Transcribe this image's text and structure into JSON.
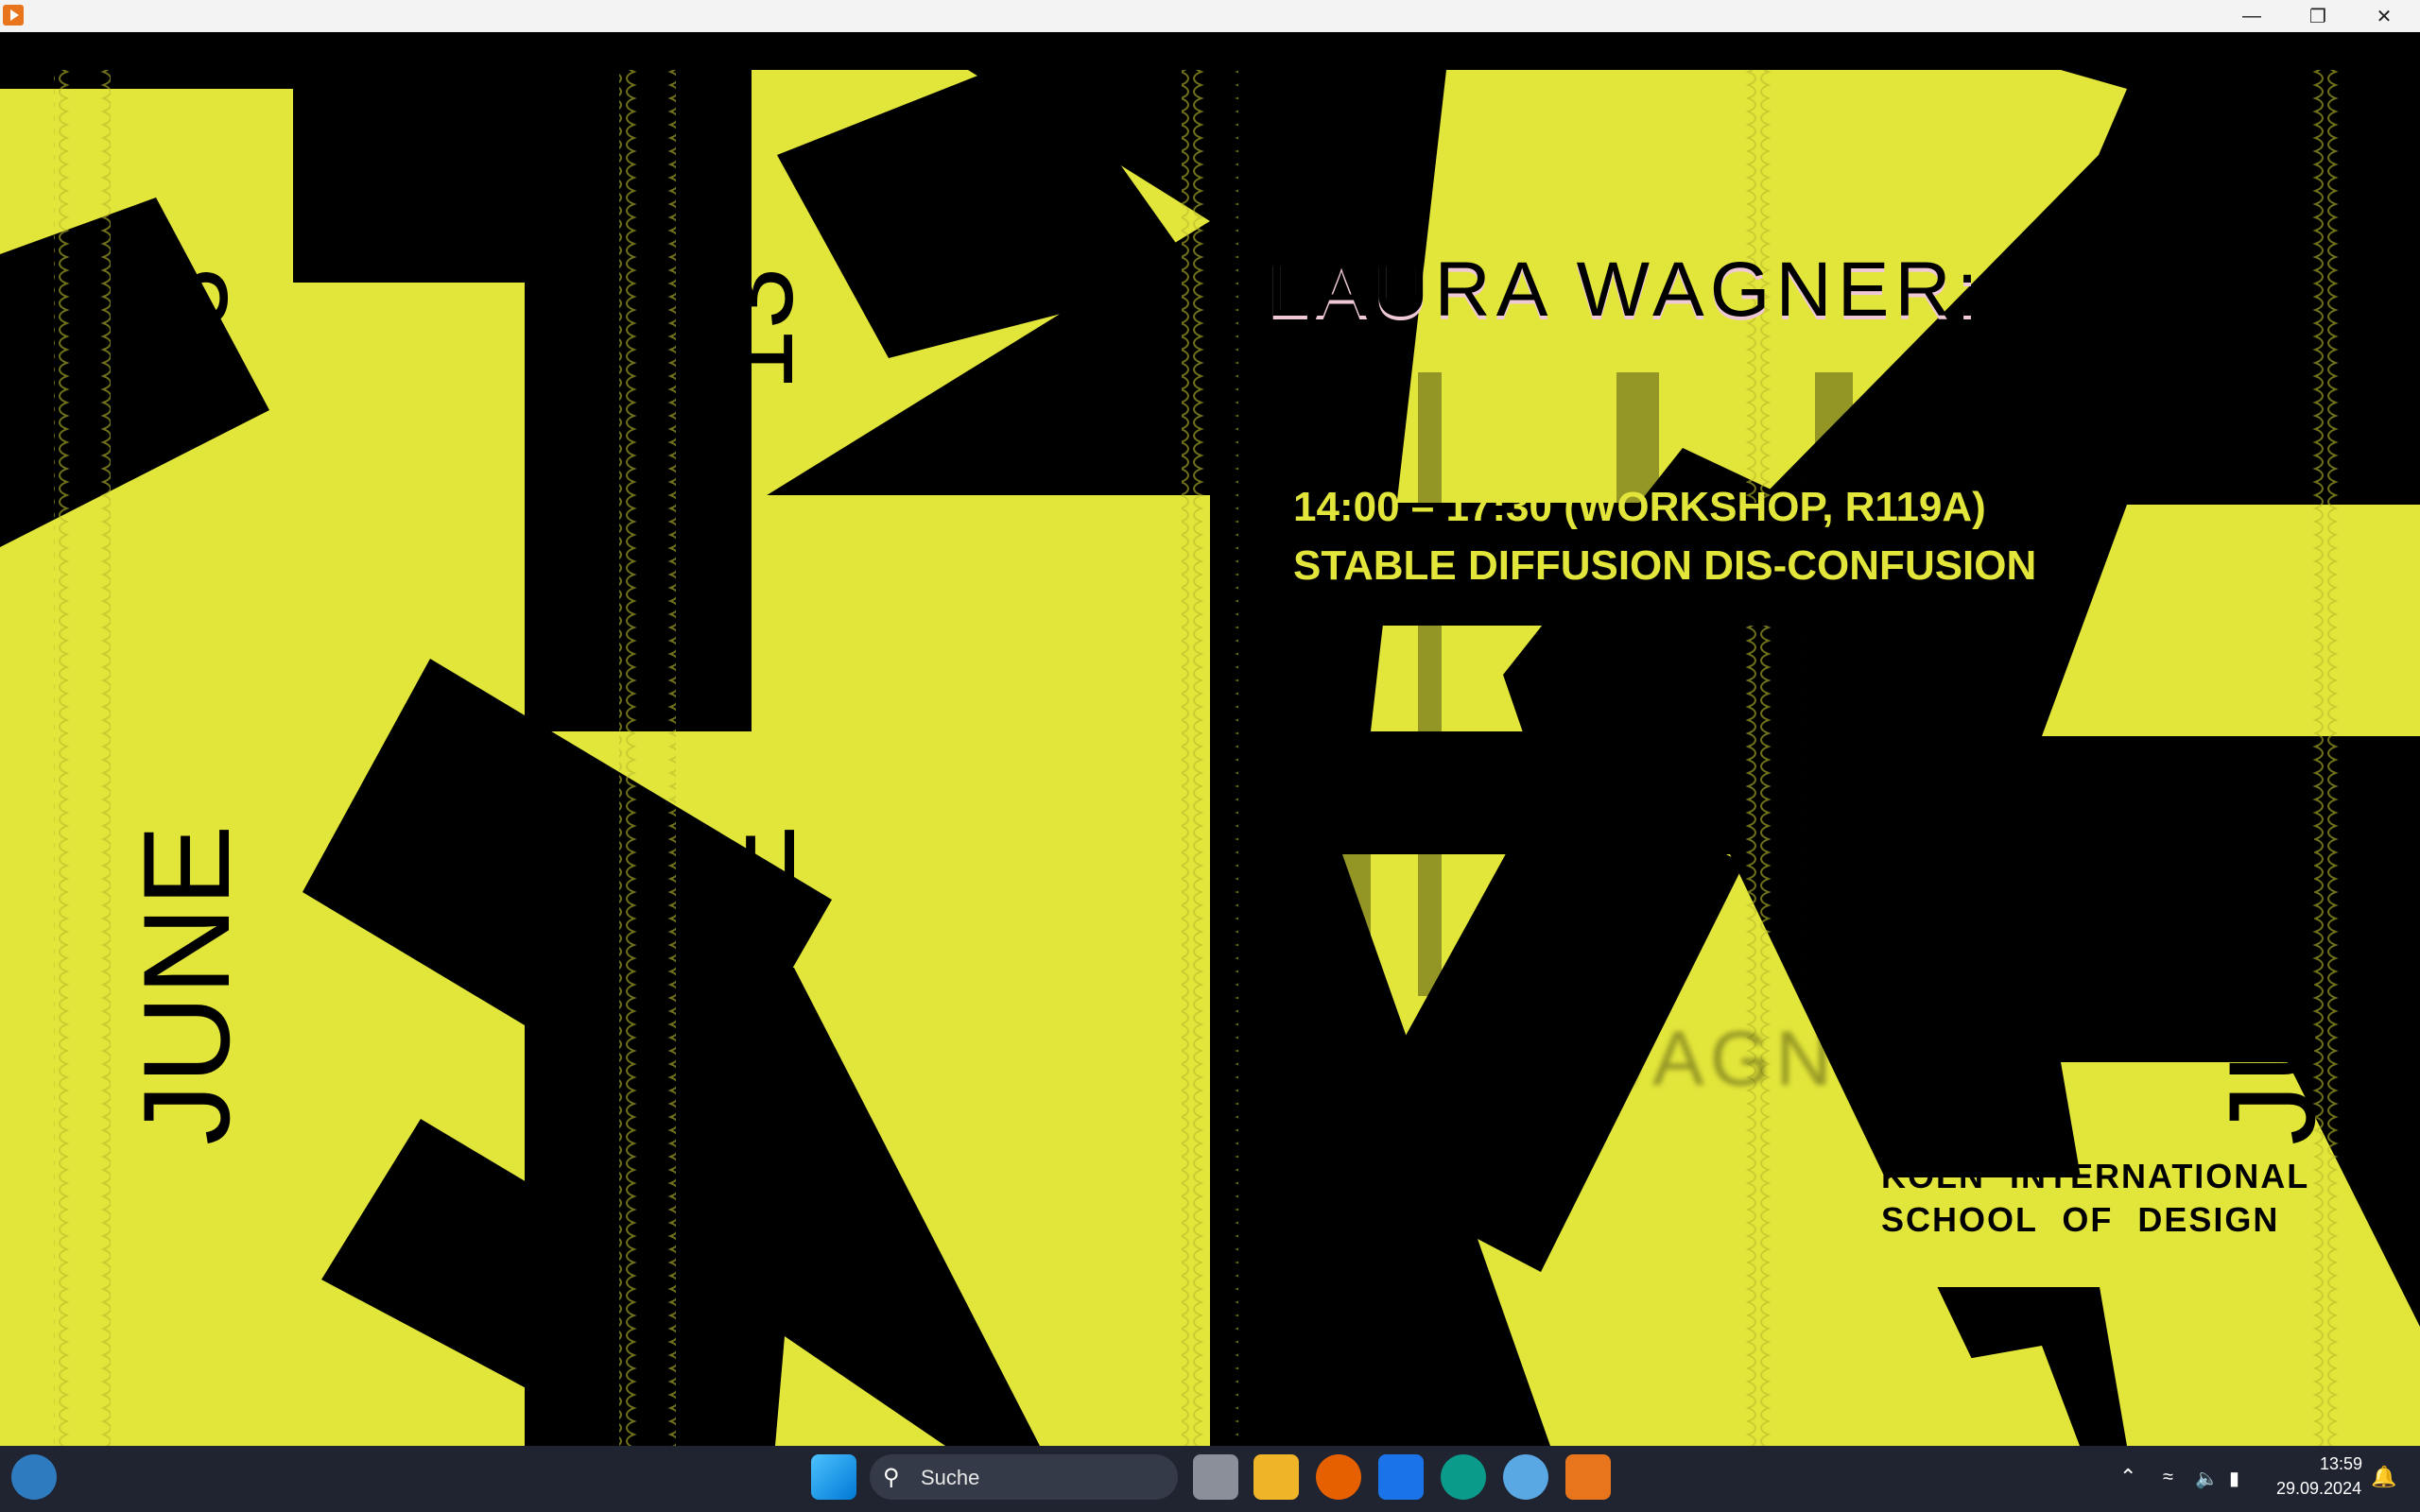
{
  "window": {
    "title": "",
    "icon": "media-player-icon"
  },
  "poster": {
    "day": "13",
    "month": "JUNE",
    "speaker": "LAURA WAGNER:",
    "time_line": "14:00 – 17:30 (WORKSHOP, R119A)",
    "event_line": "STABLE DIFFUSION DIS-CONFUSION",
    "school_line1": "KÖLN INTERNATIONAL",
    "school_line2": "SCHOOL OF DESIGN",
    "colors": {
      "accent": "#e3e63a",
      "background": "#000000"
    }
  },
  "taskbar": {
    "search_placeholder": "Suche",
    "time": "13:59",
    "date": "29.09.2024",
    "apps": [
      "start-icon",
      "search-icon",
      "task-view-icon",
      "file-explorer-icon",
      "firefox-icon",
      "docs-icon",
      "edge-icon",
      "paint-icon",
      "media-player-icon"
    ]
  }
}
